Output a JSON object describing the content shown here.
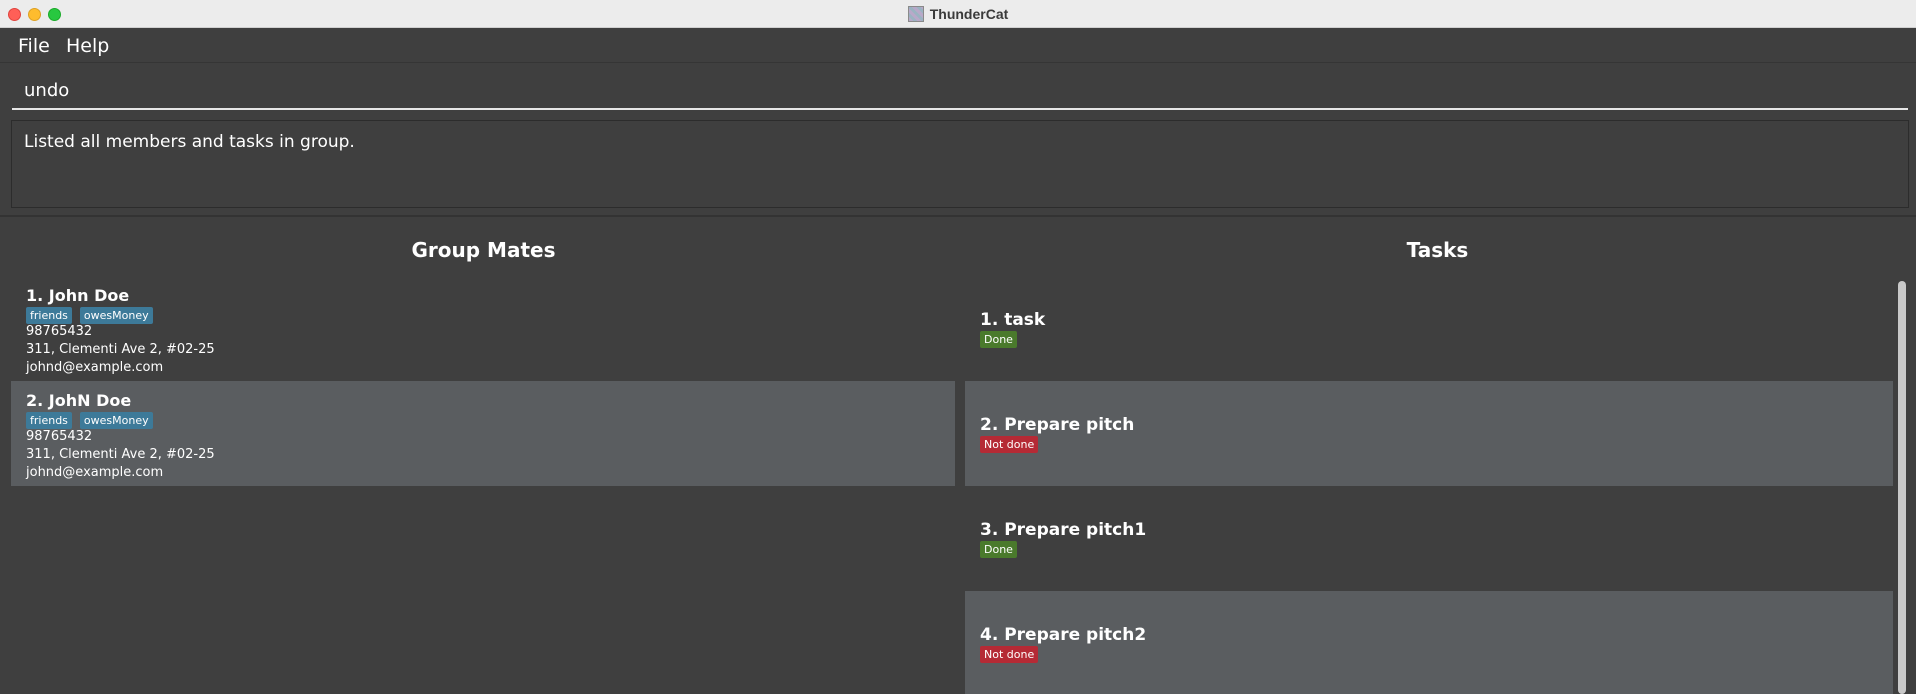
{
  "window": {
    "title": "ThunderCat"
  },
  "menu": {
    "file": "File",
    "help": "Help"
  },
  "command": {
    "value": "undo"
  },
  "result": {
    "text": "Listed all members and tasks in group."
  },
  "panels": {
    "members_title": "Group Mates",
    "tasks_title": "Tasks"
  },
  "members": [
    {
      "name": "1.  John Doe",
      "tags": [
        "friends",
        "owesMoney"
      ],
      "phone": "98765432",
      "address": "311, Clementi Ave 2, #02-25",
      "email": "johnd@example.com"
    },
    {
      "name": "2.  JohN Doe",
      "tags": [
        "friends",
        "owesMoney"
      ],
      "phone": "98765432",
      "address": "311, Clementi Ave 2, #02-25",
      "email": "johnd@example.com"
    }
  ],
  "tasks": [
    {
      "name": "1.  task",
      "status": "Done"
    },
    {
      "name": "2.  Prepare pitch",
      "status": "Not done"
    },
    {
      "name": "3.  Prepare pitch1",
      "status": "Done"
    },
    {
      "name": "4.  Prepare pitch2",
      "status": "Not done"
    }
  ],
  "colors": {
    "tag": "#3d7a99",
    "done": "#4a7a2c",
    "not_done": "#b52a35",
    "background": "#3f3f3f",
    "selected": "#5a5d60"
  }
}
